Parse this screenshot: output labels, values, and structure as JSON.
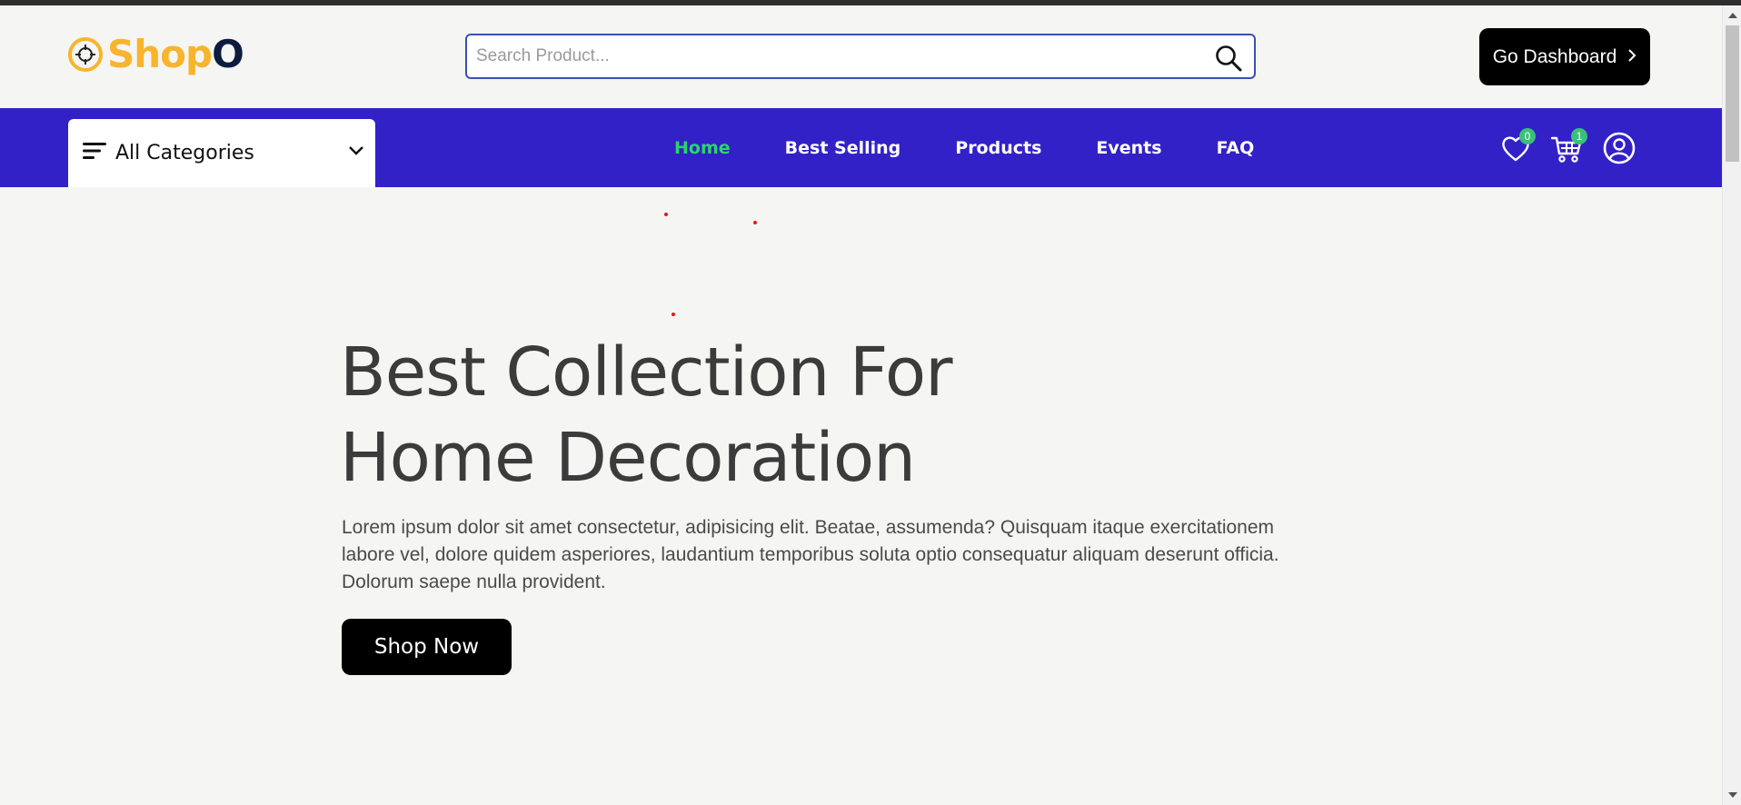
{
  "header": {
    "logo": {
      "text_main": "Shop",
      "text_end": "O",
      "brand_color": "#f8b42c",
      "dark_color": "#0d1b3e"
    },
    "search": {
      "placeholder": "Search Product...",
      "value": "",
      "icon": "search-icon"
    },
    "dashboard_button": {
      "label": "Go Dashboard",
      "icon": "chevron-right-icon"
    }
  },
  "navbar": {
    "background": "#3321c8",
    "categories": {
      "label": "All Categories",
      "icon": "menu-lines-icon",
      "chevron": "chevron-down-icon"
    },
    "links": [
      {
        "label": "Home",
        "active": true
      },
      {
        "label": "Best Selling",
        "active": false
      },
      {
        "label": "Products",
        "active": false
      },
      {
        "label": "Events",
        "active": false
      },
      {
        "label": "FAQ",
        "active": false
      }
    ],
    "active_color": "#2ad56b",
    "wishlist": {
      "icon": "heart-icon",
      "count": "0"
    },
    "cart": {
      "icon": "cart-icon",
      "count": "1"
    },
    "profile": {
      "icon": "user-circle-icon"
    }
  },
  "hero": {
    "title_line1": "Best Collection For",
    "title_line2": "Home Decoration",
    "description": "Lorem ipsum dolor sit amet consectetur, adipisicing elit. Beatae, assumenda? Quisquam itaque exercitationem labore vel, dolore quidem asperiores, laudantium temporibus soluta optio consequatur aliquam deserunt officia. Dolorum saepe nulla provident.",
    "cta_label": "Shop Now"
  }
}
